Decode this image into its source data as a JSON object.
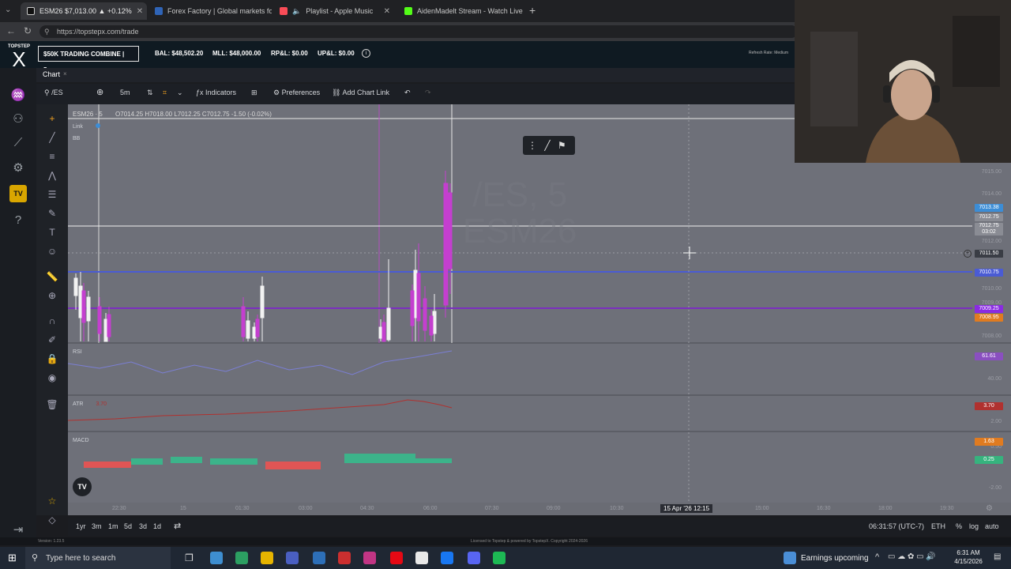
{
  "browser": {
    "tabs": [
      {
        "label": "ESM26 $7,013.00 ▲ +0.12%",
        "active": true,
        "color": "#cfd2d8"
      },
      {
        "label": "Forex Factory | Global markets for",
        "active": false,
        "color": "#2f64b7"
      },
      {
        "label": "Playlist - Apple Music",
        "active": false,
        "color": "#f94c57"
      },
      {
        "label": "AidenMadelt Stream - Watch Live",
        "active": false,
        "color": "#53fc18"
      }
    ],
    "url": "https://topstepx.com/trade"
  },
  "header": {
    "logo_top": "TOPSTEP",
    "logo_mark": "X",
    "account": "$50K TRADING COMBINE | 5...",
    "bal": "BAL: $48,502.20",
    "mll": "MLL: $48,000.00",
    "rpnl": "RP&L: $0.00",
    "upnl": "UP&L: $0.00",
    "refresh": "Refresh Rate: Medium"
  },
  "chart_tab": "Chart",
  "toolbar": {
    "symbol": "/ES",
    "interval": "5m",
    "indicators": "Indicators",
    "preferences": "Preferences",
    "add_chart_link": "Add Chart Link"
  },
  "legend": {
    "symbol": "ESM26 · 5",
    "ohlc": "O7014.25  H7018.00  L7012.25  C7012.75  -1.50 (-0.02%)",
    "link": "Link",
    "bb": "BB",
    "rsi": "RSI",
    "atr": "ATR",
    "atr_val": "3.70",
    "macd": "MACD"
  },
  "watermark": {
    "line1": "/ES, 5",
    "line2": "ESM26"
  },
  "price_axis": {
    "labels": [
      "7015.00",
      "7014.00",
      "7012.00",
      "7010.00",
      "7009.00",
      "7008.00",
      "40.00",
      "2.00",
      "0.50",
      "-2.00"
    ],
    "boxes": [
      {
        "text": "7013.38",
        "color": "#3c8dd6"
      },
      {
        "text": "7012.75",
        "color": "#8a8c94"
      },
      {
        "text": "7012.75 03:02",
        "color": "#8a8c94"
      },
      {
        "text": "7011.50",
        "color": "#3a3d45"
      },
      {
        "text": "7010.75",
        "color": "#4a5bd4"
      },
      {
        "text": "7009.25",
        "color": "#8a2be2"
      },
      {
        "text": "7008.95",
        "color": "#e07b20"
      },
      {
        "text": "61.61",
        "color": "#8a4fc0"
      },
      {
        "text": "3.70",
        "color": "#b0312f"
      },
      {
        "text": "1.63",
        "color": "#e07b20"
      },
      {
        "text": "0.25",
        "color": "#36b37e"
      }
    ]
  },
  "time_axis": [
    "22:30",
    "15",
    "01:30",
    "03:00",
    "04:30",
    "06:00",
    "07:30",
    "09:00",
    "10:30",
    "15 Apr '26  12:15",
    "15:00",
    "16:30",
    "18:00",
    "19:30"
  ],
  "bottom": {
    "ranges": [
      "1yr",
      "3m",
      "1m",
      "5d",
      "3d",
      "1d"
    ],
    "clock": "06:31:57 (UTC-7)",
    "session": "ETH",
    "pct": "%",
    "log": "log",
    "auto": "auto"
  },
  "footer": {
    "version": "Version: 1.23.5",
    "license": "Licensed to Topstep & powered by TopstepX. Copyright 2024-2026"
  },
  "taskbar": {
    "search": "Type here to search",
    "news": "Earnings upcoming",
    "time": "6:31 AM",
    "date": "4/15/2026"
  }
}
